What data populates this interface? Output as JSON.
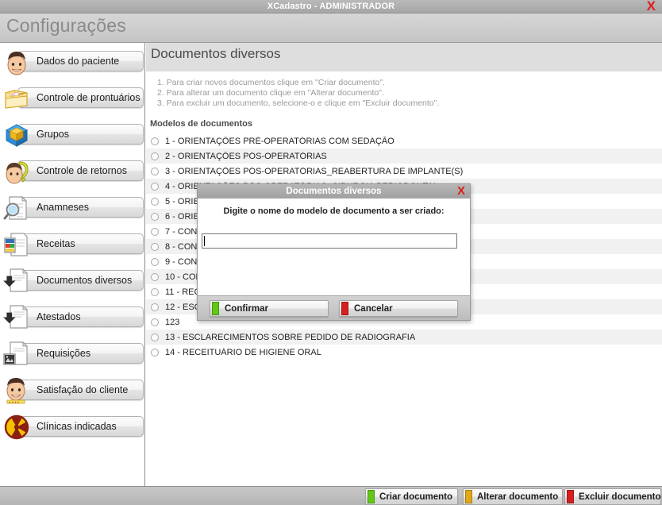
{
  "window": {
    "title": "XCadastro - ADMINISTRADOR",
    "close_icon": "close-icon",
    "close_glyph": "X"
  },
  "header": {
    "title": "Configurações"
  },
  "sidebar": {
    "items": [
      {
        "label": "Dados do paciente",
        "icon": "face-icon"
      },
      {
        "label": "Controle de prontuários",
        "icon": "folder-icon"
      },
      {
        "label": "Grupos",
        "icon": "cube-icon"
      },
      {
        "label": "Controle de retornos",
        "icon": "return-arrow-face-icon"
      },
      {
        "label": "Anamneses",
        "icon": "magnifier-document-icon"
      },
      {
        "label": "Receitas",
        "icon": "prescription-icon"
      },
      {
        "label": "Documentos diversos",
        "icon": "document-download-icon"
      },
      {
        "label": "Atestados",
        "icon": "document-download-icon"
      },
      {
        "label": "Requisições",
        "icon": "xray-document-icon"
      },
      {
        "label": "Satisfação do cliente",
        "icon": "smiling-face-icon"
      },
      {
        "label": "Clínicas indicadas",
        "icon": "radiation-icon"
      }
    ]
  },
  "main": {
    "title": "Documentos diversos",
    "instructions": [
      "1. Para criar novos documentos clique em \"Criar documento\".",
      "2. Para alterar um documento clique em \"Alterar documento\".",
      "3. Para excluir um documento, selecione-o e clique em \"Excluir documento\"."
    ],
    "models_label": "Modelos de documentos",
    "documents": [
      "1 - ORIENTAÇÕES PRÉ-OPERATÓRIAS COM SEDAÇÃO",
      "2 - ORIENTAÇÕES PÓS-OPERATÓRIAS",
      "3 - ORIENTAÇÕES PÓS-OPERATÓRIAS_REABERTURA DE IMPLANTE(S)",
      "4 - ORIENTAÇÕES PÓS-OPERATÓRIAS_CIRURGIA PERIODONTAL",
      "5 - ORIE",
      "6 - ORIE",
      "7 - CON",
      "8 - CON",
      "9 - CON",
      "10 - CON",
      "11 - REC",
      "12 - ESC",
      "123",
      "13 - ESCLARECIMENTOS SOBRE PEDIDO DE RADIOGRAFIA",
      "14 - RECEITUÁRIO DE HIGIENE ORAL"
    ]
  },
  "toolbar": {
    "buttons": [
      {
        "label": "Criar documento",
        "color": "#63c718",
        "icon": "green-swatch-icon"
      },
      {
        "label": "Alterar documento",
        "color": "#e0a81a",
        "icon": "orange-swatch-icon"
      },
      {
        "label": "Excluir documento",
        "color": "#d61f1f",
        "icon": "red-swatch-icon"
      }
    ]
  },
  "dialog": {
    "title": "Documentos diversos",
    "close_glyph": "X",
    "prompt": "Digite o nome do modelo de documento a ser criado:",
    "input_value": "",
    "input_placeholder": "",
    "confirm": {
      "label": "Confirmar",
      "color": "#63c718",
      "icon": "green-swatch-icon"
    },
    "cancel": {
      "label": "Cancelar",
      "color": "#d61f1f",
      "icon": "red-swatch-icon"
    }
  },
  "colors": {
    "accent_green": "#63c718",
    "accent_red": "#d61f1f",
    "accent_orange": "#e0a81a",
    "chrome": "#b4b4b4",
    "row_alt": "#f1f1f1"
  }
}
